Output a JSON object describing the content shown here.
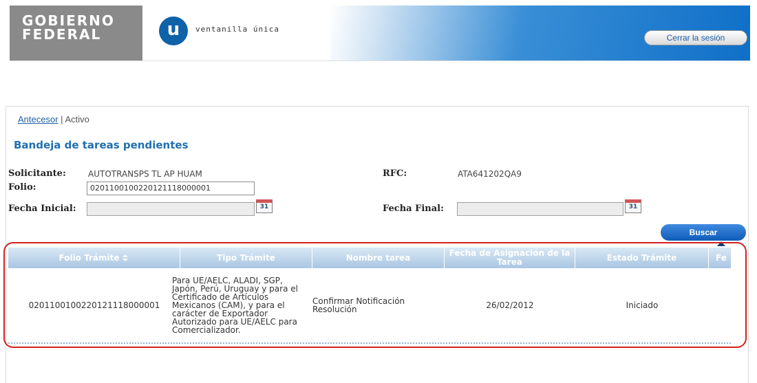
{
  "header": {
    "gob_line1": "Gobierno",
    "gob_line2": "Federal",
    "vu_letter": "u",
    "vu_name": "ventanilla única",
    "logout_label": "Cerrar la sesión"
  },
  "breadcrumb": {
    "link": "Antecesor",
    "separator": "|",
    "current": "Activo"
  },
  "page_title": "Bandeja de tareas pendientes",
  "form": {
    "solicitante_label": "Solicitante:",
    "solicitante_value": "AUTOTRANSPS TL AP HUAM",
    "rfc_label": "RFC:",
    "rfc_value": "ATA641202QA9",
    "folio_label": "Folio:",
    "folio_value": "0201100100220121118000001",
    "fecha_inicial_label": "Fecha Inicial:",
    "fecha_inicial_value": "",
    "fecha_final_label": "Fecha Final:",
    "fecha_final_value": "",
    "calendar_day": "31",
    "buscar_label": "Buscar"
  },
  "table": {
    "columns": [
      "Folio Trámite",
      "Tipo Trámite",
      "Nombre tarea",
      "Fecha de Asignación de la Tarea",
      "Estado Trámite",
      "Fe"
    ],
    "rows": [
      {
        "folio": "0201100100220121118000001",
        "tipo": "Para UE/AELC, ALADI, SGP, Japón, Perú, Uruguay y para el Certificado de Artículos Mexicanos (CAM), y para el carácter de Exportador Autorizado para UE/AELC para Comercializador.",
        "nombre": "Confirmar Notificación Resolución",
        "fecha": "26/02/2012",
        "estado": "Iniciado"
      }
    ]
  },
  "colors": {
    "brand_blue": "#1f6fb0",
    "highlight_red": "#d41f1f",
    "header_gray": "#8a8a8a"
  }
}
